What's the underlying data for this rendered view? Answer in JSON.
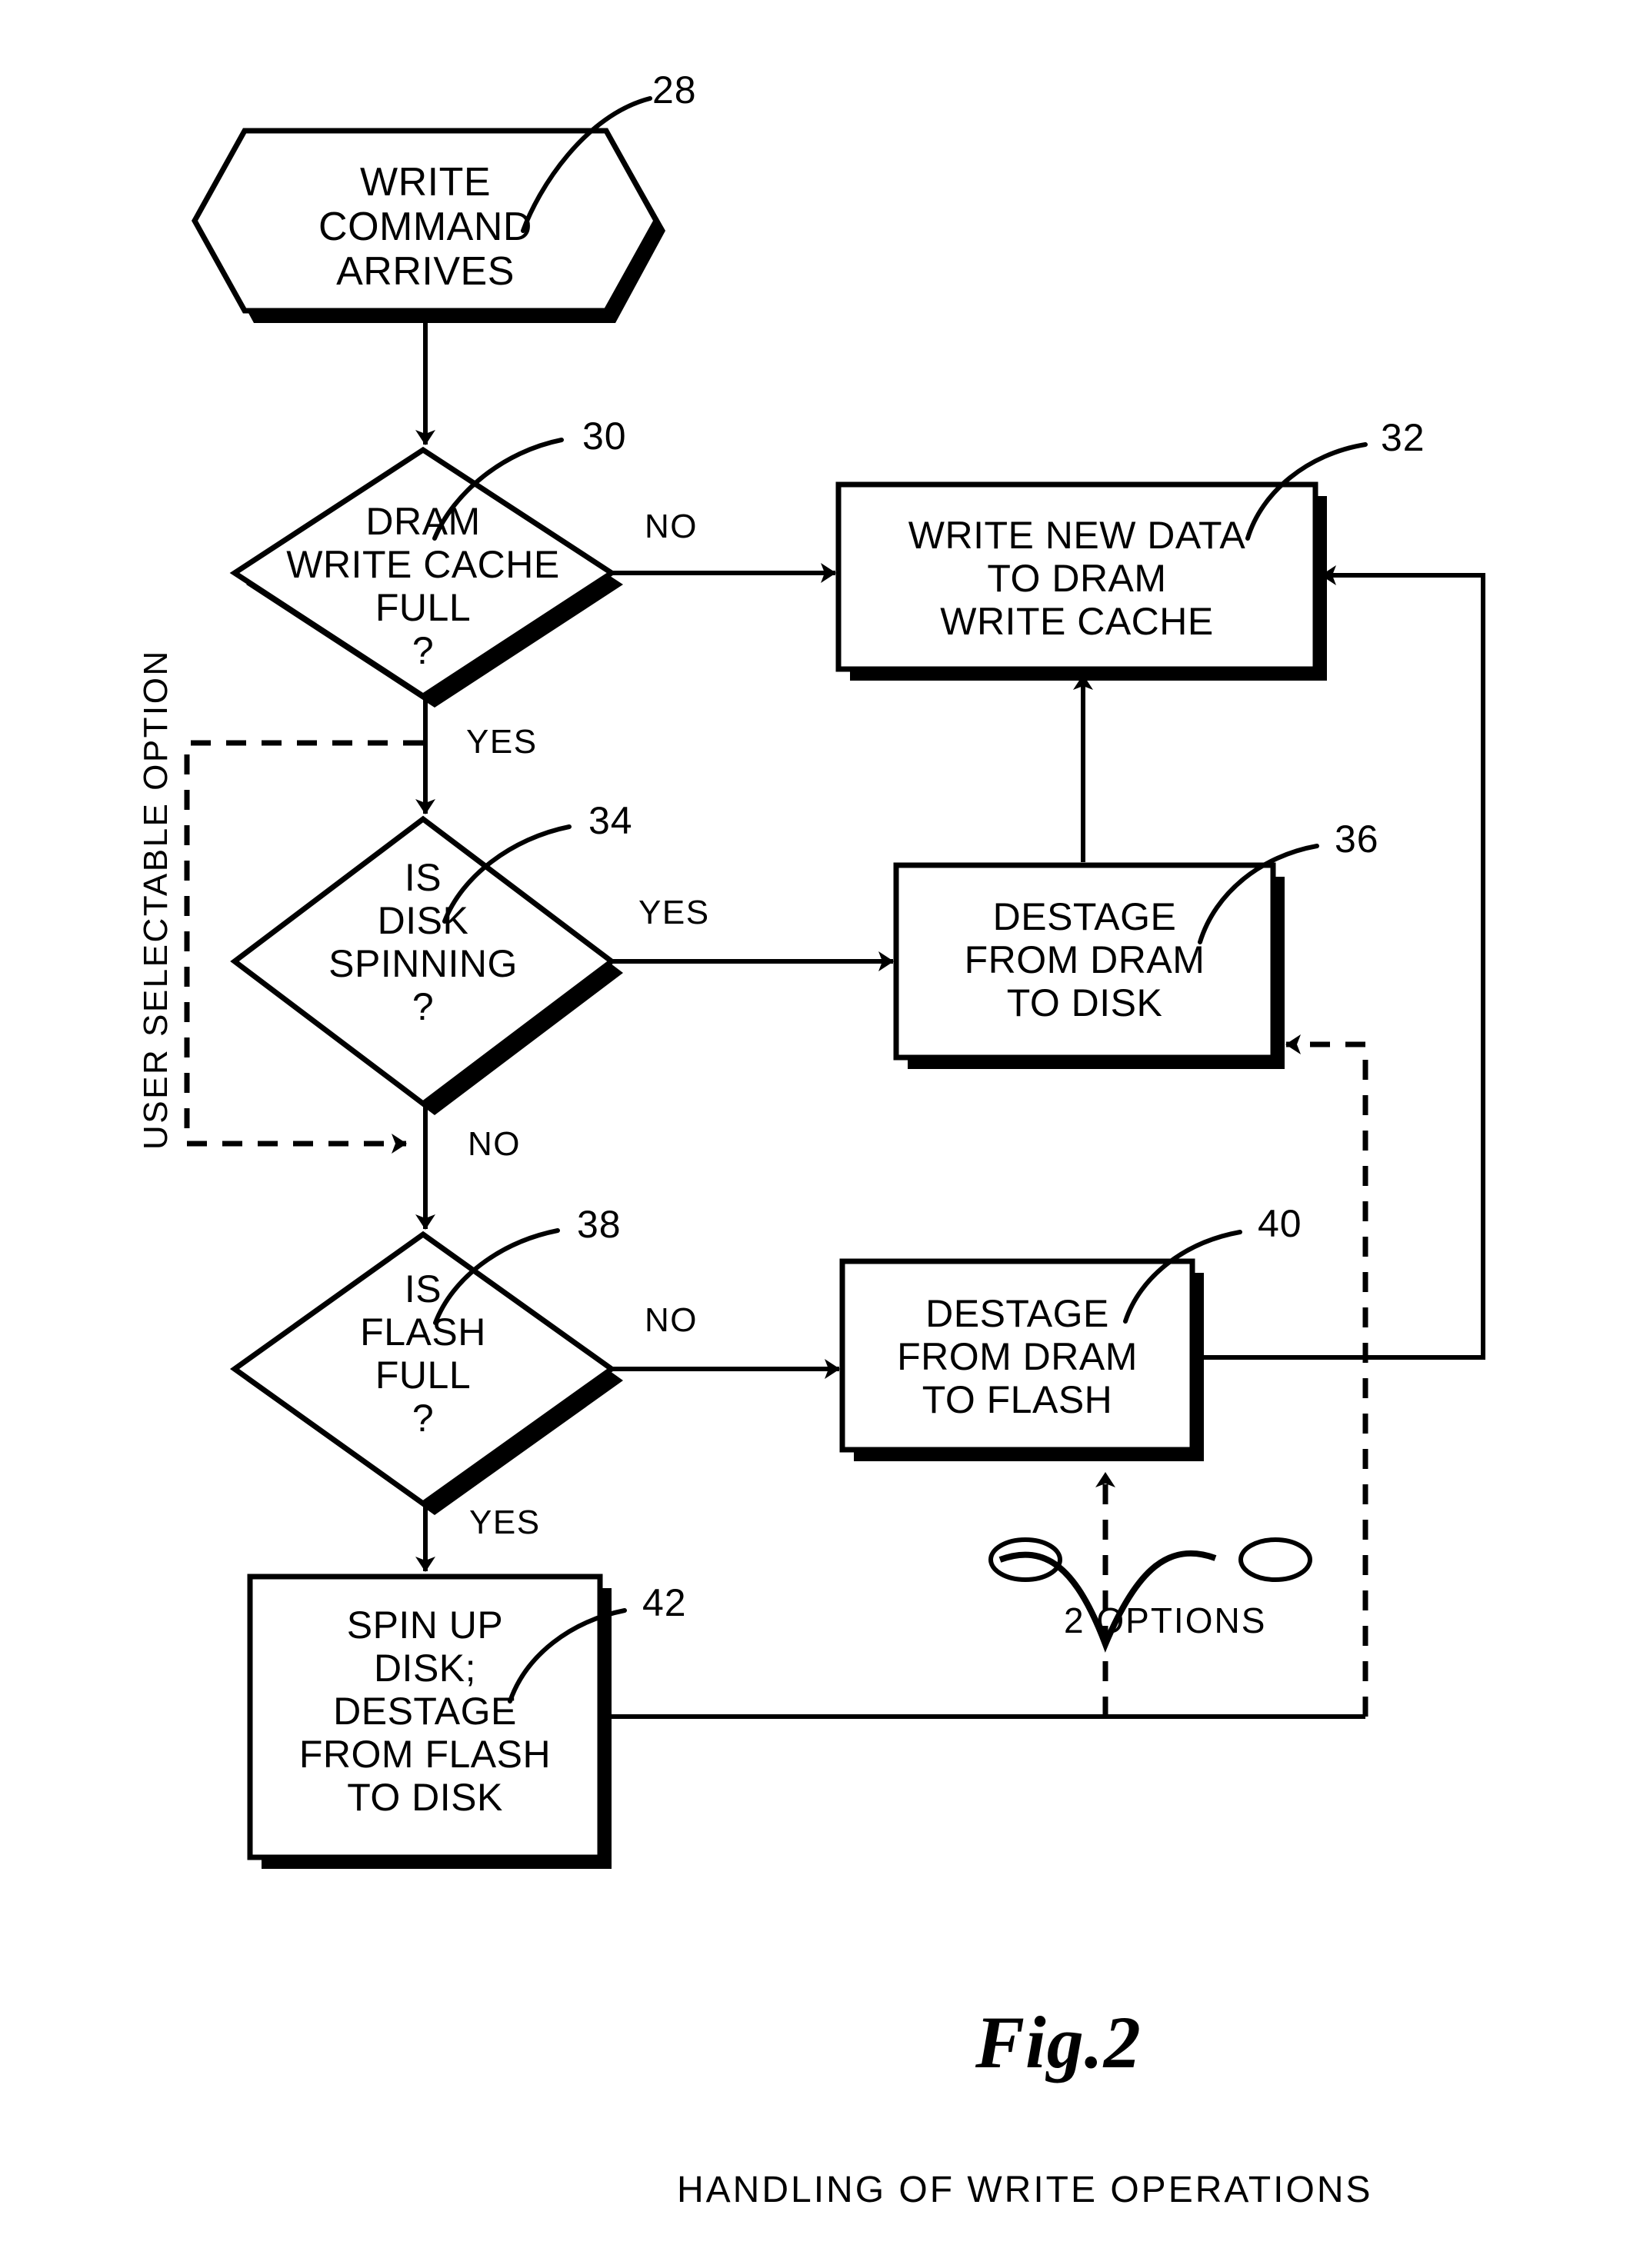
{
  "figure": {
    "title": "Fig.2",
    "caption": "HANDLING OF WRITE OPERATIONS"
  },
  "annotations": {
    "user_selectable_option": "USER SELECTABLE OPTION",
    "two_options": "2 OPTIONS"
  },
  "nodes": [
    {
      "id": "n28",
      "ref": "28",
      "shape": "hexagon",
      "text": "WRITE\nCOMMAND\nARRIVES"
    },
    {
      "id": "n30",
      "ref": "30",
      "shape": "diamond",
      "text": "DRAM\nWRITE CACHE\nFULL\n?"
    },
    {
      "id": "n32",
      "ref": "32",
      "shape": "rect",
      "text": "WRITE  NEW  DATA\nTO  DRAM\nWRITE  CACHE"
    },
    {
      "id": "n34",
      "ref": "34",
      "shape": "diamond",
      "text": "IS\nDISK\nSPINNING\n?"
    },
    {
      "id": "n36",
      "ref": "36",
      "shape": "rect",
      "text": "DESTAGE\nFROM  DRAM\nTO  DISK"
    },
    {
      "id": "n38",
      "ref": "38",
      "shape": "diamond",
      "text": "IS\nFLASH\nFULL\n?"
    },
    {
      "id": "n40",
      "ref": "40",
      "shape": "rect",
      "text": "DESTAGE\nFROM  DRAM\nTO  FLASH"
    },
    {
      "id": "n42",
      "ref": "42",
      "shape": "rect",
      "text": "SPIN  UP\nDISK;\nDESTAGE\nFROM  FLASH\nTO  DISK"
    }
  ],
  "edge_labels": {
    "dram_full_no": "NO",
    "dram_full_yes": "YES",
    "disk_spinning_yes": "YES",
    "disk_spinning_no": "NO",
    "flash_full_no": "NO",
    "flash_full_yes": "YES"
  },
  "colors": {
    "ink": "#000000",
    "paper": "#ffffff"
  }
}
